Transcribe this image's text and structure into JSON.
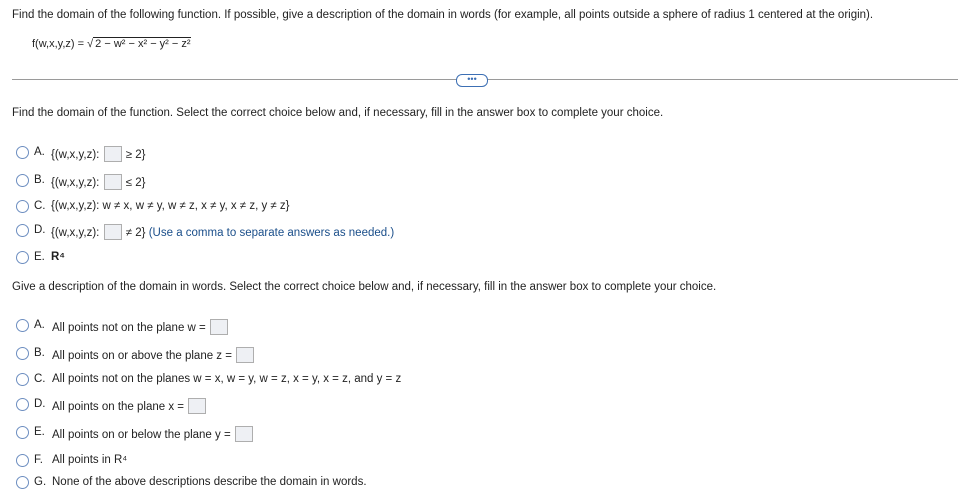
{
  "question": {
    "prompt": "Find the domain of the following function. If possible, give a description of the domain in words (for example, all points outside a sphere of radius 1 centered at the origin).",
    "function_lhs": "f(w,x,y,z) =",
    "function_rhs": "2 − w² − x² − y² − z²"
  },
  "divider": {
    "more_label": "•••"
  },
  "part1": {
    "instruction": "Find the domain of the function. Select the correct choice below and, if necessary, fill in the answer box to complete your choice.",
    "options": [
      {
        "letter": "A.",
        "pre": "{(w,x,y,z):",
        "post": "≥ 2}",
        "hint": ""
      },
      {
        "letter": "B.",
        "pre": "{(w,x,y,z):",
        "post": "≤ 2}",
        "hint": ""
      },
      {
        "letter": "C.",
        "pre": "{(w,x,y,z): w ≠ x, w ≠ y, w ≠ z, x ≠ y, x ≠ z, y ≠ z}",
        "post": "",
        "hint": ""
      },
      {
        "letter": "D.",
        "pre": "{(w,x,y,z):",
        "post": "≠ 2}",
        "hint": "(Use a comma to separate answers as needed.)"
      },
      {
        "letter": "E.",
        "pre": "R⁴",
        "post": "",
        "hint": ""
      }
    ]
  },
  "part2": {
    "instruction": "Give a description of the domain in words. Select the correct choice below and, if necessary, fill in the answer box to complete your choice.",
    "options": [
      {
        "letter": "A.",
        "text": "All points not on the plane w ="
      },
      {
        "letter": "B.",
        "text": "All points on or above the plane z ="
      },
      {
        "letter": "C.",
        "text": "All points not on the planes w = x, w = y, w = z, x = y, x = z, and y = z"
      },
      {
        "letter": "D.",
        "text": "All points on the plane x ="
      },
      {
        "letter": "E.",
        "text": "All points on or below the plane y ="
      },
      {
        "letter": "F.",
        "text": "All points in R⁴"
      },
      {
        "letter": "G.",
        "text": "None of the above descriptions describe the domain in words."
      }
    ]
  }
}
